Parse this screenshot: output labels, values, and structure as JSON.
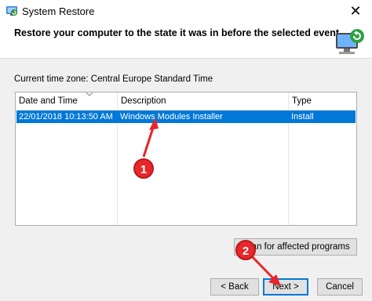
{
  "window": {
    "title": "System Restore",
    "close_glyph": "✕",
    "app_icon": "system-restore-icon"
  },
  "header": {
    "title": "Restore your computer to the state it was in before the selected event",
    "graphic_icon": "restore-computer-icon"
  },
  "timezone_label": "Current time zone: Central Europe Standard Time",
  "table": {
    "columns": [
      "Date and Time",
      "Description",
      "Type"
    ],
    "rows": [
      {
        "date": "22/01/2018 10:13:50 AM",
        "description": "Windows Modules Installer",
        "type": "Install",
        "selected": true
      }
    ]
  },
  "buttons": {
    "scan": "Scan for affected programs",
    "back": "< Back",
    "next": "Next >",
    "cancel": "Cancel"
  },
  "annotations": {
    "badge_1": "1",
    "badge_2": "2",
    "color": "#e8262b"
  },
  "colors": {
    "selection": "#0078d7"
  }
}
